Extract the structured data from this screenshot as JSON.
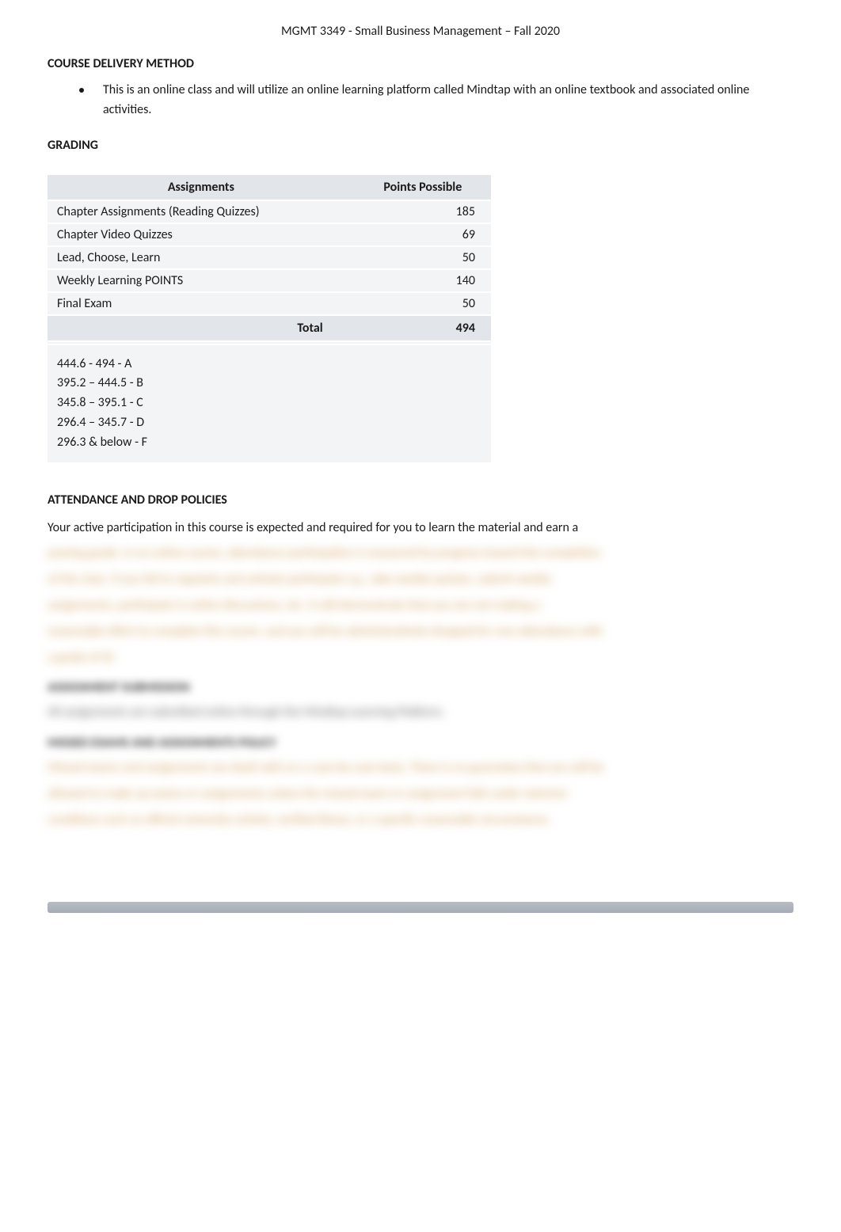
{
  "header": "MGMT 3349 - Small Business Management – Fall 2020",
  "sections": {
    "delivery": {
      "heading": "COURSE DELIVERY METHOD",
      "bullet": "This is an online class and will utilize an online learning platform called Mindtap with an online textbook and associated online activities."
    },
    "grading": {
      "heading": "GRADING",
      "col_assignments": "Assignments",
      "col_points": "Points Possible",
      "rows": [
        {
          "name": "Chapter Assignments (Reading Quizzes)",
          "points": "185"
        },
        {
          "name": "Chapter Video Quizzes",
          "points": "69"
        },
        {
          "name": "Lead, Choose, Learn",
          "points": "50"
        },
        {
          "name": "Weekly Learning POINTS",
          "points": "140"
        },
        {
          "name": "Final Exam",
          "points": "50"
        }
      ],
      "total_label": "Total",
      "total_points": "494",
      "scale": [
        "444.6 - 494 - A",
        "395.2 – 444.5 - B",
        "345.8 – 395.1 - C",
        "296.4 – 345.7 - D",
        "296.3 & below - F"
      ]
    },
    "attendance": {
      "heading": "ATTENDANCE AND DROP POLICIES",
      "visible_line": "Your active participation in this course is expected and required for you to learn the material and earn a"
    }
  },
  "obscured": {
    "para1_lines": [
      "passing grade. In an online course, attendance participation is measured by progress toward the completion",
      "of the class. If you fail to regularly and actively participate e.g., take weekly quizzes, submit weekly",
      "assignments, participate in online discussions, etc. it will demonstrate that you are not making a",
      "reasonable effort to complete this course, and you will be administratively dropped for non-attendance with",
      "a grade of W."
    ],
    "heading2": "ASSIGNMENT SUBMISSION",
    "line2": "All assignments are submitted online through the Mindtap Learning Platform.",
    "heading3": "MISSED EXAMS AND ASSIGNMENTS POLICY",
    "para3_lines": [
      "Missed exams and assignments are dealt with on a case-by-case basis. There is no guarantee that you will be",
      "allowed to make up exams or assignments unless the missed exam or assignment falls under extreme",
      "conditions such as official university activity, verified illness, or a specific reasonable circumstance."
    ]
  }
}
